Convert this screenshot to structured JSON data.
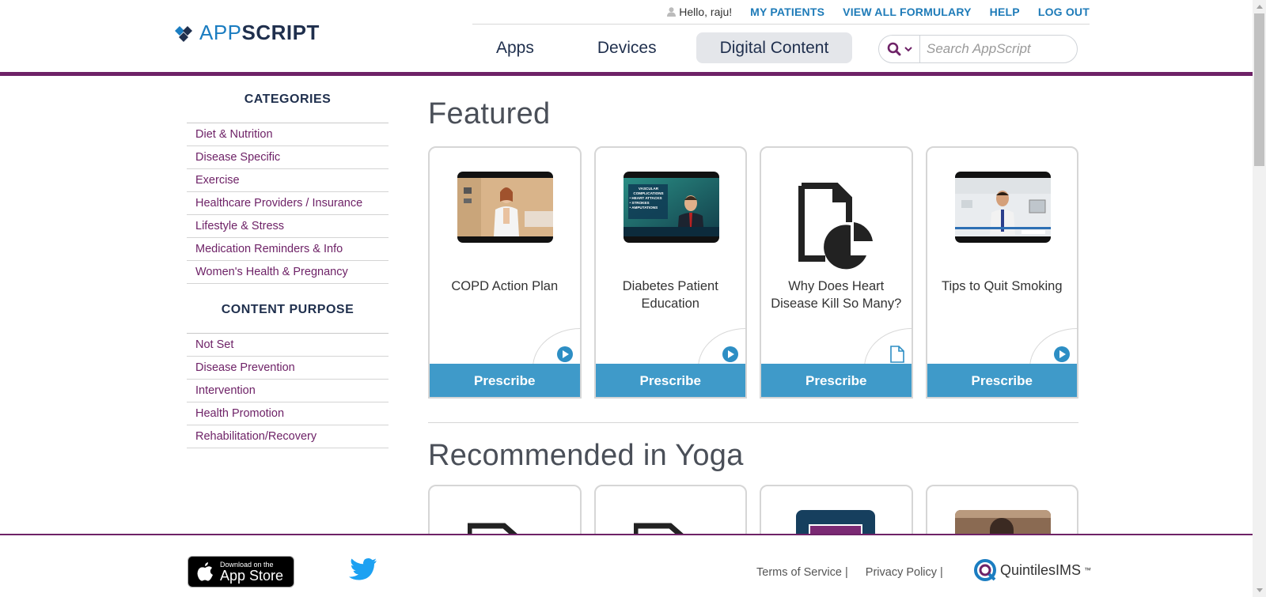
{
  "brand": {
    "app": "APP",
    "script": "SCRIPT"
  },
  "topnav": {
    "greeting": "Hello, raju!",
    "links": [
      "MY PATIENTS",
      "VIEW ALL FORMULARY",
      "HELP",
      "LOG OUT"
    ]
  },
  "mainnav": {
    "tabs": [
      "Apps",
      "Devices",
      "Digital Content"
    ],
    "active": "Digital Content"
  },
  "search": {
    "placeholder": "Search AppScript"
  },
  "sidebar": {
    "categories_heading": "CATEGORIES",
    "categories": [
      "Diet & Nutrition",
      "Disease Specific",
      "Exercise",
      "Healthcare Providers / Insurance",
      "Lifestyle & Stress",
      "Medication Reminders & Info",
      "Women's Health & Pregnancy"
    ],
    "purpose_heading": "CONTENT PURPOSE",
    "purposes": [
      "Not Set",
      "Disease Prevention",
      "Intervention",
      "Health Promotion",
      "Rehabilitation/Recovery"
    ]
  },
  "featured": {
    "title": "Featured",
    "cards": [
      {
        "title": "COPD Action Plan",
        "type": "video",
        "button": "Prescribe",
        "thumb_icon": "doctor-video-thumbnail"
      },
      {
        "title": "Diabetes Patient Education",
        "type": "video",
        "button": "Prescribe",
        "thumb_icon": "news-anchor-video-thumbnail",
        "thumb_text": [
          "VASCULAR",
          "COMPLICATIONS",
          "• HEART ATTACKS",
          "• STROKES",
          "• AMPUTATIONS"
        ]
      },
      {
        "title": "Why Does Heart Disease Kill So Many?",
        "type": "document",
        "button": "Prescribe",
        "thumb_icon": "document-chart-icon"
      },
      {
        "title": "Tips to Quit Smoking",
        "type": "video",
        "button": "Prescribe",
        "thumb_icon": "doctor-office-video-thumbnail"
      }
    ]
  },
  "recommended": {
    "title": "Recommended in Yoga"
  },
  "footer": {
    "appstore_small": "Download on the",
    "appstore_big": "App Store",
    "links": [
      "Terms of Service |",
      "Privacy Policy |"
    ],
    "partner": "QuintilesIMS",
    "partner_tm": "™"
  },
  "colors": {
    "accent": "#6e2267",
    "link": "#1e7bb8",
    "button": "#3f9ac9",
    "navy": "#1f2f4d"
  }
}
